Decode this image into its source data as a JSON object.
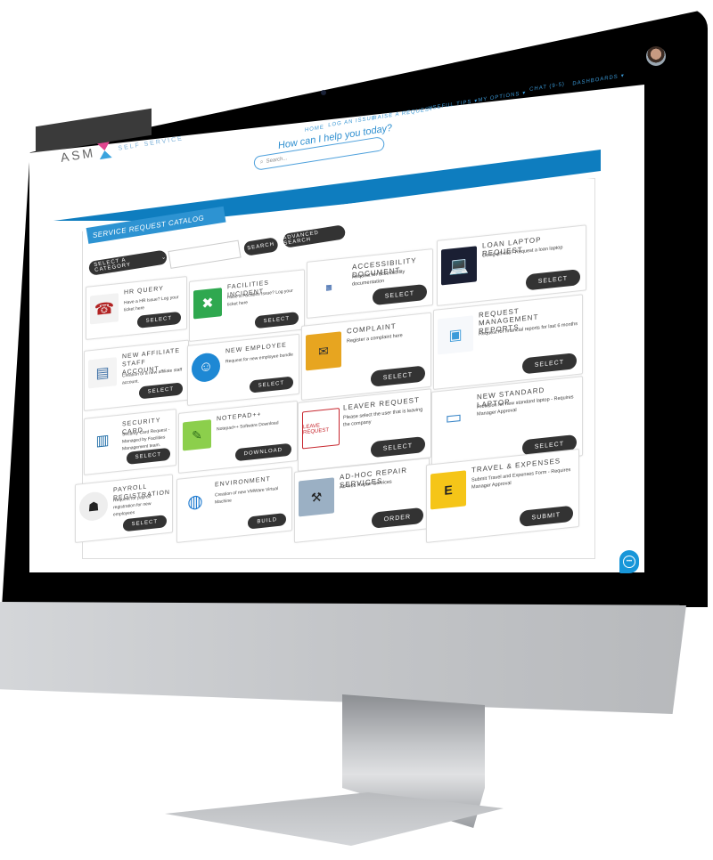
{
  "app": {
    "logo_text": "ASM",
    "logo_subtitle": "SELF SERVICE",
    "brand_colors": {
      "pink": "#e0458f",
      "blue": "#3aa3de",
      "band": "#0e7dbf",
      "link": "#3a97d4",
      "button": "#333333"
    }
  },
  "nav": {
    "items": [
      {
        "label": "HOME"
      },
      {
        "label": "LOG AN ISSUE"
      },
      {
        "label": "RAISE A REQUEST"
      },
      {
        "label": "USEFUL TIPS ▾"
      },
      {
        "label": "MY OPTIONS ▾"
      },
      {
        "label": "CHAT (9-5)"
      },
      {
        "label": "DASHBOARDS ▾"
      }
    ]
  },
  "hero": {
    "title": "How can I help you today?",
    "search_placeholder": "Search...",
    "search_icon": "search-icon"
  },
  "catalog": {
    "header": "SERVICE REQUEST CATALOG",
    "category_select": "SELECT A CATEGORY",
    "category_chevron": "⌄",
    "search_input_value": "",
    "search_button": "SEARCH",
    "advanced_search_button": "ADVANCED SEARCH",
    "cards": [
      {
        "id": "hr-query",
        "title": "HR QUERY",
        "desc": "Have a HR Issue? Log your ticket here",
        "button": "SELECT",
        "icon": "phone-icon"
      },
      {
        "id": "facilities-incident",
        "title": "FACILITIES INCIDENT",
        "desc": "Have a Facilities Issue? Log your ticket here",
        "button": "SELECT",
        "icon": "tools-icon"
      },
      {
        "id": "accessibility-document",
        "title": "ACCESSIBILITY DOCUMENT",
        "desc": "Request for accessibility documentation",
        "button": "SELECT",
        "icon": "accessibility-grid-icon"
      },
      {
        "id": "loan-laptop-request",
        "title": "LOAN LAPTOP REQUEST",
        "desc": "Going off site? Request a loan laptop",
        "button": "SELECT",
        "icon": "laptop-icon"
      },
      {
        "id": "new-affiliate-staff-account",
        "title": "NEW AFFILIATE STAFF ACCOUNT",
        "desc": "Creation of a new affiliate staff account.",
        "button": "SELECT",
        "icon": "id-card-icon"
      },
      {
        "id": "new-employee",
        "title": "NEW EMPLOYEE",
        "desc": "Request for new employee bundle",
        "button": "SELECT",
        "icon": "employee-icon"
      },
      {
        "id": "complaint",
        "title": "COMPLAINT",
        "desc": "Register a complaint here",
        "button": "SELECT",
        "icon": "complaint-key-icon"
      },
      {
        "id": "request-management-reports",
        "title": "REQUEST MANAGEMENT REPORTS",
        "desc": "Request for financial reports for last 6 months",
        "button": "SELECT",
        "icon": "report-icon"
      },
      {
        "id": "security-card",
        "title": "SECURITY CARD",
        "desc": "Security Card Request - Managed by Facilities Management team.",
        "button": "SELECT",
        "icon": "badge-icon"
      },
      {
        "id": "notepad-plus-plus",
        "title": "NOTEPAD++",
        "desc": "Notepad++ Software Download",
        "button": "DOWNLOAD",
        "icon": "notepad-icon"
      },
      {
        "id": "leaver-request",
        "title": "LEAVER REQUEST",
        "desc": "Please select the user that is leaving the company",
        "button": "SELECT",
        "icon": "leave-stamp-icon",
        "icon_text": "LEAVE REQUEST"
      },
      {
        "id": "new-standard-laptop",
        "title": "NEW STANDARD LAPTOP",
        "desc": "Provision for new standard laptop - Requires Manager Approval",
        "button": "SELECT",
        "icon": "new-laptop-icon"
      },
      {
        "id": "payroll-registration",
        "title": "PAYROLL REGISTRATION",
        "desc": "Request for payroll registration for new employees",
        "button": "SELECT",
        "icon": "payroll-icon"
      },
      {
        "id": "environment",
        "title": "ENVIRONMENT",
        "desc": "Creation of new VMWare Virtual Machine",
        "button": "BUILD",
        "icon": "globe-icon"
      },
      {
        "id": "ad-hoc-repair-services",
        "title": "AD-HOC REPAIR SERVICES",
        "desc": "Ad-Hoc Repair Services",
        "button": "ORDER",
        "icon": "repair-icon"
      },
      {
        "id": "travel-expenses",
        "title": "TRAVEL & EXPENSES",
        "desc": "Submit Travel and Expenses Form - Requires Manager Approval",
        "button": "SUBMIT",
        "icon": "travel-icon",
        "icon_letter": "E"
      }
    ]
  },
  "chat": {
    "icon": "chat-bubble-icon",
    "glyph": "•••"
  }
}
